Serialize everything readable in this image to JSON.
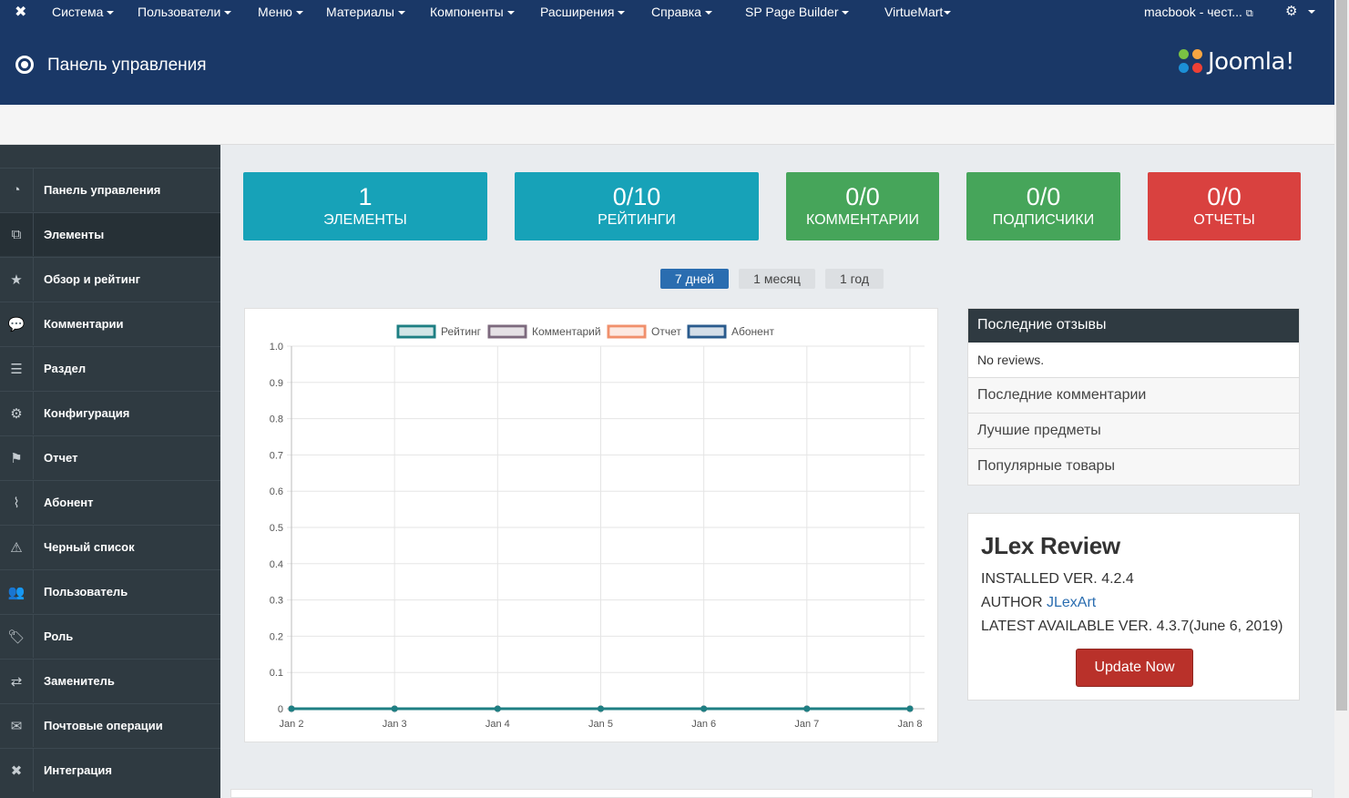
{
  "topnav": {
    "items": [
      {
        "label": "Система"
      },
      {
        "label": "Пользователи"
      },
      {
        "label": "Меню"
      },
      {
        "label": "Материалы"
      },
      {
        "label": "Компоненты"
      },
      {
        "label": "Расширения"
      },
      {
        "label": "Справка"
      },
      {
        "label": "SP Page Builder"
      },
      {
        "label": "VirtueMart"
      }
    ],
    "site_link": "macbook - чест...",
    "gear_icon": "gear-icon"
  },
  "header": {
    "title": "Панель управления",
    "logo_text": "Joomla!"
  },
  "sidebar": {
    "items": [
      {
        "label": "Панель управления",
        "icon": "dashboard-icon"
      },
      {
        "label": "Элементы",
        "icon": "copy-icon"
      },
      {
        "label": "Обзор и рейтинг",
        "icon": "star-icon"
      },
      {
        "label": "Комментарии",
        "icon": "comments-icon"
      },
      {
        "label": "Раздел",
        "icon": "list-icon"
      },
      {
        "label": "Конфигурация",
        "icon": "cogs-icon"
      },
      {
        "label": "Отчет",
        "icon": "flag-icon"
      },
      {
        "label": "Абонент",
        "icon": "rss-icon"
      },
      {
        "label": "Черный список",
        "icon": "warning-icon"
      },
      {
        "label": "Пользователь",
        "icon": "users-icon"
      },
      {
        "label": "Роль",
        "icon": "tags-icon"
      },
      {
        "label": "Заменитель",
        "icon": "exchange-icon"
      },
      {
        "label": "Почтовые операции",
        "icon": "envelope-icon"
      },
      {
        "label": "Интеграция",
        "icon": "joomla-icon"
      }
    ]
  },
  "stats": [
    {
      "value": "1",
      "label": "ЭЛЕМЕНТЫ",
      "color": "#17a2b8"
    },
    {
      "value": "0/10",
      "label": "РЕЙТИНГИ",
      "color": "#17a2b8"
    },
    {
      "value": "0/0",
      "label": "КОММЕНТАРИИ",
      "color": "#46a55a"
    },
    {
      "value": "0/0",
      "label": "ПОДПИСЧИКИ",
      "color": "#46a55a"
    },
    {
      "value": "0/0",
      "label": "ОТЧЕТЫ",
      "color": "#d9413f"
    }
  ],
  "range_tabs": [
    {
      "label": "7 дней",
      "active": true
    },
    {
      "label": "1 месяц",
      "active": false
    },
    {
      "label": "1 год",
      "active": false
    }
  ],
  "chart_data": {
    "type": "line",
    "x": [
      "Jan 2",
      "Jan 3",
      "Jan 4",
      "Jan 5",
      "Jan 6",
      "Jan 7",
      "Jan 8"
    ],
    "series": [
      {
        "name": "Рейтинг",
        "values": [
          0,
          0,
          0,
          0,
          0,
          0,
          0
        ],
        "color": "#1e7f83"
      },
      {
        "name": "Комментарий",
        "values": [
          0,
          0,
          0,
          0,
          0,
          0,
          0
        ],
        "color": "#7d6a7e"
      },
      {
        "name": "Отчет",
        "values": [
          0,
          0,
          0,
          0,
          0,
          0,
          0
        ],
        "color": "#f0906c"
      },
      {
        "name": "Абонент",
        "values": [
          0,
          0,
          0,
          0,
          0,
          0,
          0
        ],
        "color": "#2a5b8d"
      }
    ],
    "yticks": [
      "1.0",
      "0.9",
      "0.8",
      "0.7",
      "0.6",
      "0.5",
      "0.4",
      "0.3",
      "0.2",
      "0.1",
      "0"
    ],
    "ylim": [
      0,
      1
    ],
    "grid": true,
    "legend": "top-center"
  },
  "reviews_panel": {
    "title": "Последние отзывы",
    "empty_text": "No reviews.",
    "rows": [
      "Последние комментарии",
      "Лучшие предметы",
      "Популярные товары"
    ]
  },
  "jlex": {
    "title": "JLex Review",
    "installed": "INSTALLED VER. 4.2.4",
    "author_prefix": "AUTHOR ",
    "author_link": "JLexArt",
    "latest": "LATEST AVAILABLE VER. 4.3.7(June 6, 2019)",
    "update_button": "Update Now"
  }
}
